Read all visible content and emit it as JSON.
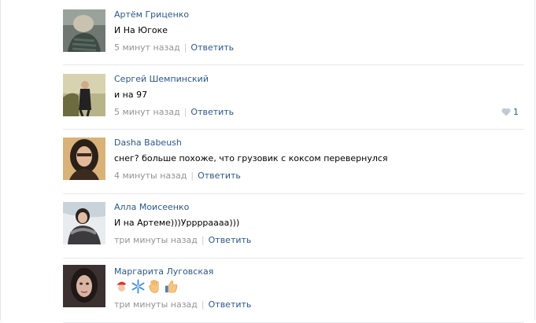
{
  "comments": [
    {
      "author": "Артём Гриценко",
      "text": "И На Югоке",
      "time": "5 минут назад",
      "reply": "Ответить"
    },
    {
      "author": "Сергей Шемпинский",
      "text": "и на 97",
      "time": "5 минут назад",
      "reply": "Ответить",
      "likes": "1"
    },
    {
      "author": "Dasha Babeush",
      "text": "снег? больше похоже, что грузовик с коксом перевернулся",
      "time": "4 минуты назад",
      "reply": "Ответить"
    },
    {
      "author": "Алла Моисеенко",
      "text": "И на Артеме)))Урррраааа)))",
      "time": "три минуты назад",
      "reply": "Ответить"
    },
    {
      "author": "Маргарита Луговская",
      "emoji": [
        "santa-emoji",
        "snowflake-emoji",
        "raised-hand-emoji",
        "thumbs-up-emoji"
      ],
      "time": "три минуты назад",
      "reply": "Ответить"
    }
  ],
  "colors": {
    "link": "#2a5885",
    "meta": "#939393",
    "divider": "#e7e8ec"
  }
}
